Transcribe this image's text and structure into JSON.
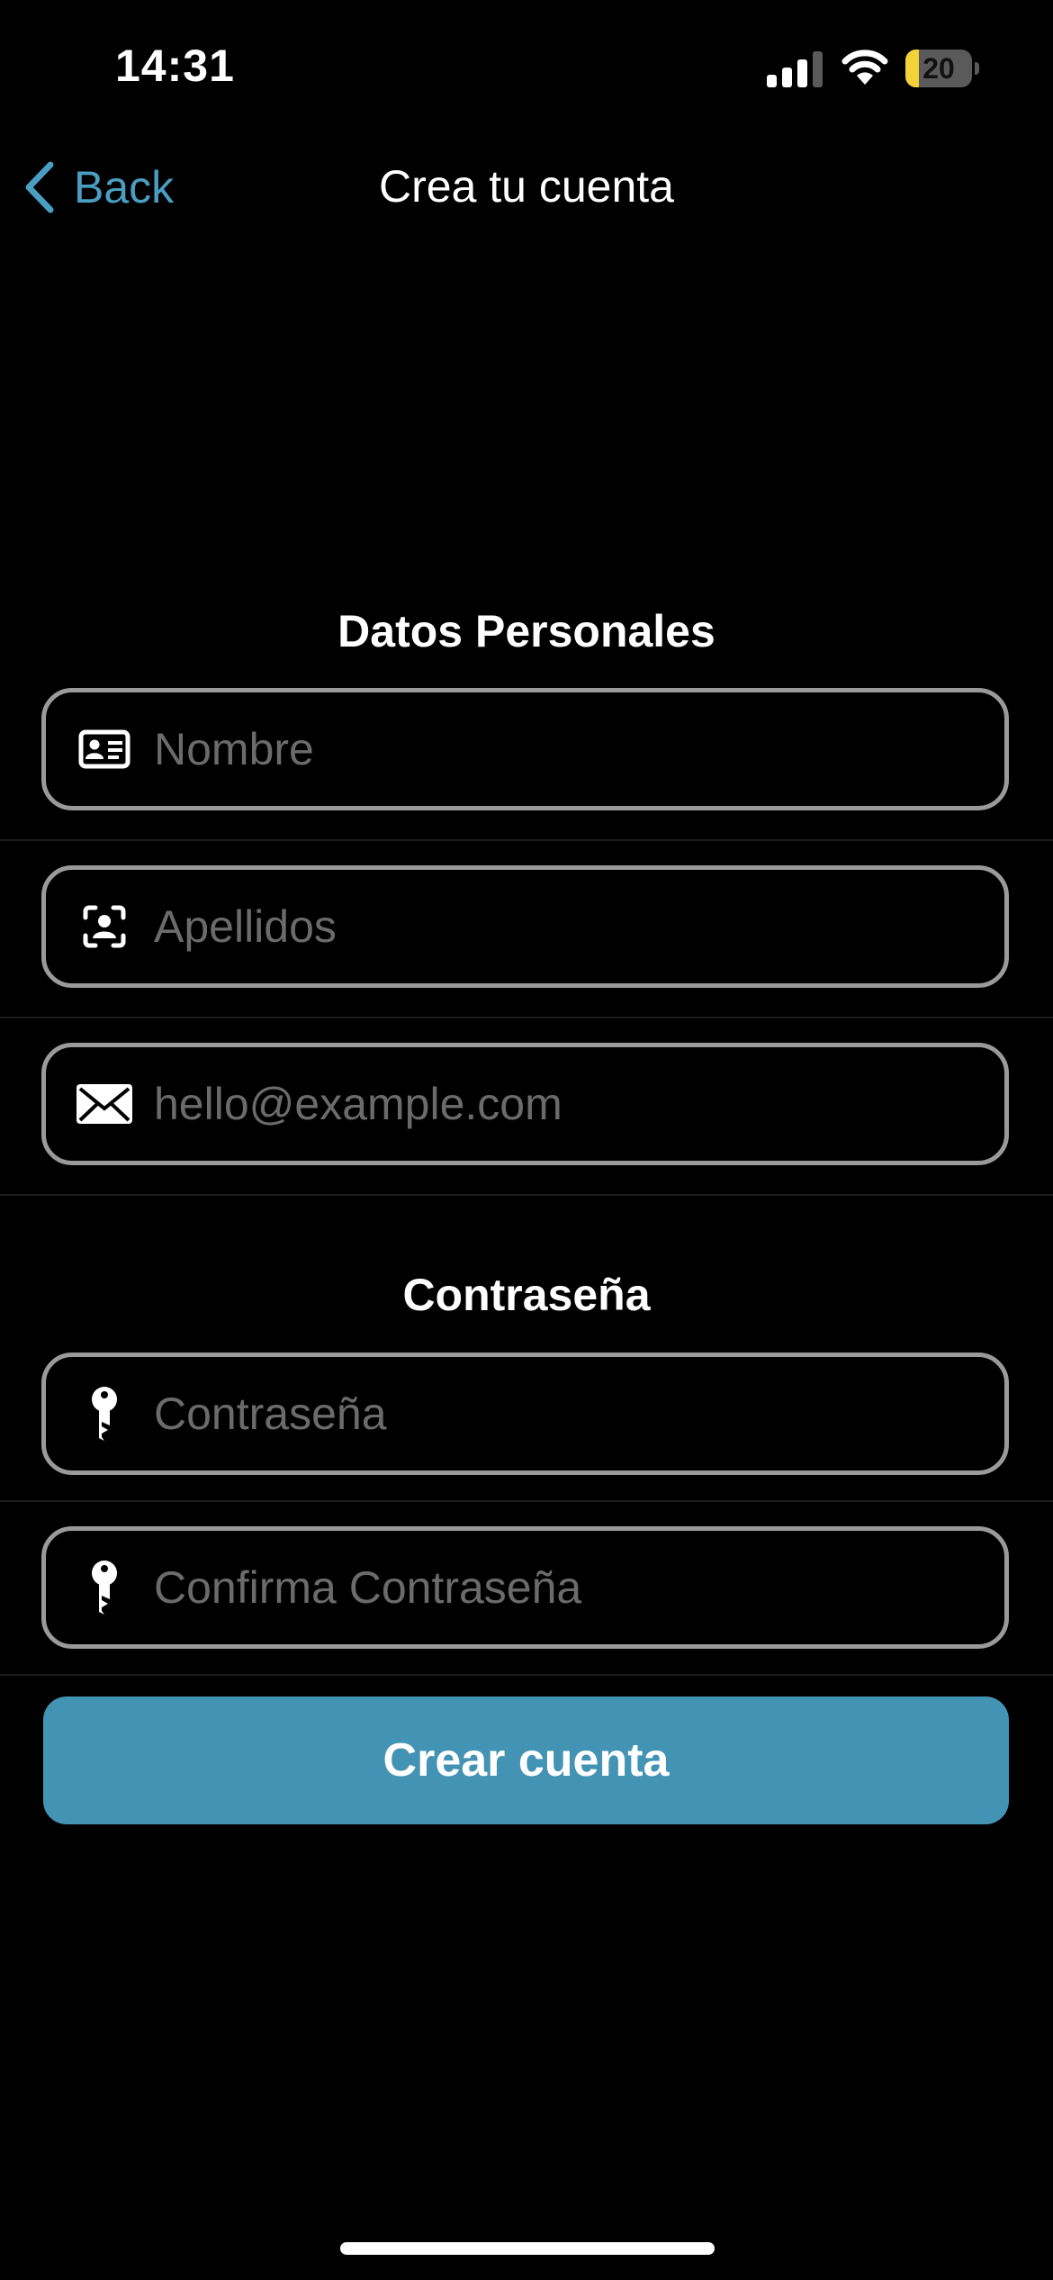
{
  "status_bar": {
    "time": "14:31",
    "battery_level": "20",
    "battery_fraction": 0.2
  },
  "nav": {
    "back_label": "Back",
    "title": "Crea tu cuenta"
  },
  "personal": {
    "title": "Datos Personales",
    "name_placeholder": "Nombre",
    "surname_placeholder": "Apellidos",
    "email_placeholder": "hello@example.com"
  },
  "password": {
    "title": "Contraseña",
    "password_placeholder": "Contraseña",
    "confirm_placeholder": "Confirma Contraseña"
  },
  "actions": {
    "create_label": "Crear cuenta"
  },
  "icons": {
    "back": "chevron-left-icon",
    "name": "id-card-icon",
    "surname": "person-viewfinder-icon",
    "email": "envelope-icon",
    "password": "key-icon",
    "confirm": "key-icon"
  },
  "colors": {
    "accent": "#4a9ec1",
    "button": "#4394b4",
    "battery": "#f3d23a"
  }
}
